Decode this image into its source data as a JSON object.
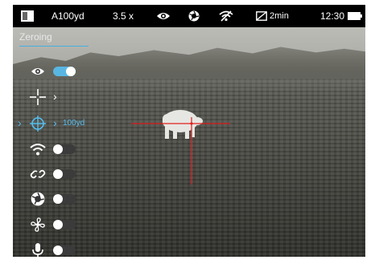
{
  "status_bar": {
    "profile": "A100yd",
    "zoom": "3.5 x",
    "timer": "2min",
    "clock": "12:30",
    "icons": [
      "display-mode-icon",
      "eye-icon",
      "shutter-icon",
      "wifi-off-icon",
      "display-off-timer-icon",
      "battery-icon"
    ]
  },
  "menu": {
    "title": "Zeroing",
    "items": [
      {
        "name": "display-item",
        "icon": "eye-icon",
        "control": "toggle",
        "state": "on"
      },
      {
        "name": "crosshair-item",
        "icon": "crosshair-icon",
        "control": "chevron"
      },
      {
        "name": "zeroing-distance-item",
        "icon": "target-icon",
        "control": "chevron",
        "value": "100yd",
        "selected": true
      },
      {
        "name": "wifi-item",
        "icon": "wifi-icon",
        "control": "toggle",
        "state": "off"
      },
      {
        "name": "link-item",
        "icon": "link-icon",
        "control": "toggle",
        "state": "off"
      },
      {
        "name": "shutter-item",
        "icon": "shutter-icon",
        "control": "toggle",
        "state": "off"
      },
      {
        "name": "fan-item",
        "icon": "fan-icon",
        "control": "toggle",
        "state": "off"
      },
      {
        "name": "microphone-item",
        "icon": "microphone-icon",
        "control": "toggle",
        "state": "off"
      }
    ]
  },
  "colors": {
    "accent": "#55bfee",
    "reticle": "#e0201f",
    "status_bar_bg": "#000000"
  }
}
